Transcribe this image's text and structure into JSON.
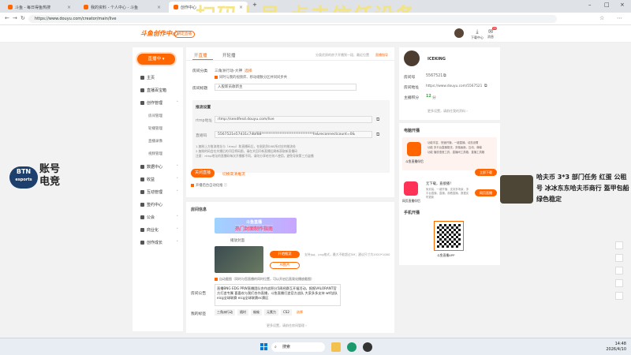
{
  "browser": {
    "tabs": [
      {
        "label": "斗鱼 - 每日得鱼热搜",
        "active": false
      },
      {
        "label": "我的资料 - 个人中心 - 斗鱼",
        "active": false
      },
      {
        "label": "创作中心",
        "active": true
      }
    ],
    "url": "https://www.douyu.com/creator/main/live",
    "watermark": "扫码上号 点击信任设备"
  },
  "header": {
    "logo": "斗鱼创作中心",
    "bind_label": "绑定直播",
    "download_label": "下载中心",
    "notify_label": "消息",
    "notify_count": "20"
  },
  "sidebar": {
    "live_button": "直播中",
    "items": [
      {
        "label": "主页"
      },
      {
        "label": "直播百宝箱"
      },
      {
        "label": "创作管理"
      }
    ],
    "subitems": [
      "房间管理",
      "轮播管理",
      "直播录像",
      "视频管理"
    ],
    "items2": [
      {
        "label": "数据中心"
      },
      {
        "label": "收益"
      },
      {
        "label": "互动管理"
      },
      {
        "label": "签约中心"
      },
      {
        "label": "公会"
      },
      {
        "label": "商业化"
      },
      {
        "label": "创作成长"
      }
    ]
  },
  "main": {
    "tab_live": "开直播",
    "tab_replay": "开轮播",
    "top_hint": "分类优质的房子开播到一段、最近位置",
    "top_link": "直播指导",
    "room_category_label": "房间分类",
    "room_category_value": "三角洲行动-大神",
    "room_category_action": "选择",
    "sync_note": "同时与我的视频库、移动端数分区并同同步共",
    "room_title_label": "房间标题",
    "room_title_value": "入股新员收新主",
    "push_title": "推流设置",
    "rtmp_label": "rtmp地址",
    "rtmp_value": "rtmp://sendfesd.douyu.com/live",
    "code_label": "直播码",
    "code_value": "5567521e57d31c7dbf88*****************************fn&reconnectcount=0&",
    "notes": [
      "1.复制上方推流地址与（rtmp）和直播码后，在粘贴到OBS所对应的推流处",
      "2.复制的码会在关播后的开回将码图，请在关回开新直播后刷新获取新直播码",
      "注意：rtmp地址的直播码每次开播都不同，请勿分享给任何人使用，避免导致第三方盗播"
    ],
    "close_live_button": "关闭直播",
    "hd_link": "切换高清推流",
    "stream_check": "开播后台自动化推",
    "info_title": "房间信息",
    "banner_title": "斗鱼直播",
    "banner_sub": "热门封面制作指南",
    "cover_label": "播放封面",
    "cover_live_button": "开始推流",
    "cover_ai_button": "AI图片",
    "cover_hint": "支持jpg、png格式，最大不能超过5M；建议尺寸为1920*1080",
    "cover_check": "自动截图（同时与您直播的同时位置，可以开启后直观化播放截图）",
    "notice_label": "房间公告",
    "notice_value": "直播BNG EDG PRW直播团队合作战积分5周经赛互开福活动，报报VALORANT官方打造专属 喜喜欢与我们合作直播，斗鱼直播打造官方战队 大家多多支持 wtf战队 eicg全球联赛 eicg全球联赛ec赛区",
    "tags_label": "我的标签",
    "tags": [
      "三角洲行动",
      "随时",
      "偷偷",
      "元素力",
      "CS2"
    ],
    "tags_action": "选择",
    "more_settings": "更多设置，请前往房间管理"
  },
  "profile": {
    "name": "ICEKING",
    "room_id_label": "房间号",
    "room_id": "5567521",
    "room_url_label": "房间地址",
    "room_url": "https://www.douyu.com/5567521",
    "level_label": "主播积分",
    "level_value": "12",
    "level_unit": "分",
    "more": "更多设置，请前往我的资料"
  },
  "pc_live": {
    "title": "电脑开播",
    "client_name": "斗鱼直播伴侣",
    "features": [
      "功能丰富，快速开播，一键直播，动态设置",
      "功能 多平台直播推流，多路画面，互动，弹幕",
      "功能 播放语音工具，直播间工具箱，直播工具箱"
    ],
    "download_button": "立即下载",
    "web_title": "无下载，直接播！",
    "web_desc": "免安装，一键开播，支持多场景，多平台直播，直播，观看直播，数据实时更新",
    "web_name": "网页直播伴侣",
    "web_button": "网页直播",
    "mobile_title": "手机开播",
    "app_name": "斗鱼直播APP"
  },
  "overlay": {
    "left_logo_1": "BTN",
    "left_logo_2": "esports",
    "left_text_1": "账号",
    "left_text_2": "电竞",
    "right_text": "哈夫币 3*3 部门任务 红蛋 公租号 冰冰东东哈夫币商行 盔甲包船 绿色稳定"
  },
  "taskbar": {
    "search": "搜索",
    "time": "14:48",
    "date": "2026/4/10"
  }
}
